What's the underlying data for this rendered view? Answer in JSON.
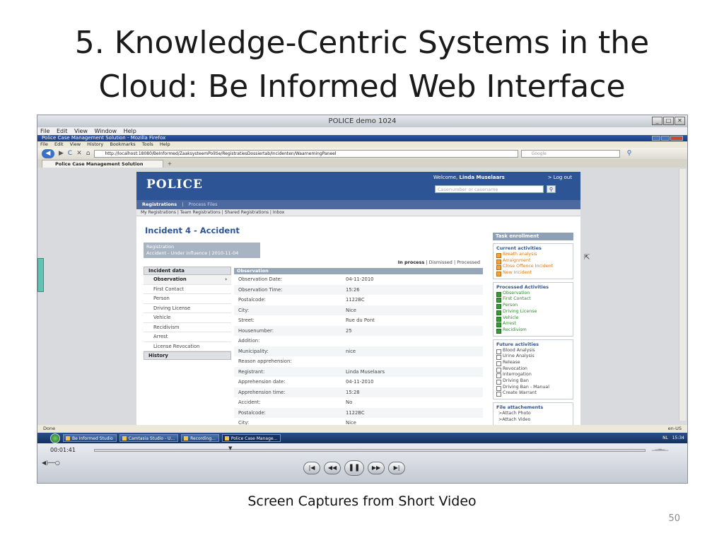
{
  "slide": {
    "title_line1": "5. Knowledge-Centric Systems in the",
    "title_line2": "Cloud: Be Informed Web Interface",
    "caption": "Screen Captures from Short Video",
    "page_number": "50"
  },
  "outer_window": {
    "title": "POLICE demo 1024",
    "menu": [
      "File",
      "Edit",
      "View",
      "Window",
      "Help"
    ]
  },
  "firefox": {
    "title": "Police Case Management Solution - Mozilla Firefox",
    "menu": [
      "File",
      "Edit",
      "View",
      "History",
      "Bookmarks",
      "Tools",
      "Help"
    ],
    "url": "http://localhost:18080/BeInformed/ZaaksysteemPolitie/RegistratiesDossiertab/Incidenten/WaarnemingPaneel",
    "search_placeholder": "Google",
    "tab_label": "Police Case Management Solution",
    "new_tab": "+",
    "status": "Done",
    "language": "en-US"
  },
  "app": {
    "logo": "POLICE",
    "welcome_prefix": "Welcome,",
    "user_name": "Linda Muselaars",
    "logout": "> Log out",
    "search_placeholder": "Casenumber or casename",
    "tabs": {
      "active": "Registrations",
      "sep": "|",
      "other": "Process Files"
    },
    "subnav": "My Registrations | Team Registrations | Shared Registrations | Inbox",
    "incident_title": "Incident 4 - Accident",
    "registration_label": "Registration",
    "registration_detail": "Accident - Under influence | 2010-11-04",
    "status": {
      "current": "In process",
      "rest": " | Dismissed | Processed"
    },
    "side_nav": {
      "header": "Incident data",
      "items": [
        "Observation",
        "First Contact",
        "Person",
        "Driving License",
        "Vehicle",
        "Recidivism",
        "Arrest",
        "License Revocation"
      ],
      "footer": "History"
    },
    "observation": {
      "header": "Observation",
      "rows": [
        {
          "k": "Observation Date:",
          "v": "04-11-2010"
        },
        {
          "k": "Observation Time:",
          "v": "15:26"
        },
        {
          "k": "Postalcode:",
          "v": "1122BC"
        },
        {
          "k": "City:",
          "v": "Nice"
        },
        {
          "k": "Street:",
          "v": "Rue du Pont"
        },
        {
          "k": "Housenumber:",
          "v": "25"
        },
        {
          "k": "Addition:",
          "v": ""
        },
        {
          "k": "Municipality:",
          "v": "nice"
        },
        {
          "k": "Reason apprehension:",
          "v": ""
        },
        {
          "k": "Registrant:",
          "v": "Linda Muselaars"
        },
        {
          "k": "Apprehension date:",
          "v": "04-11-2010"
        },
        {
          "k": "Apprehension time:",
          "v": "15:28"
        },
        {
          "k": "Accident:",
          "v": "No"
        },
        {
          "k": "Postalcode:",
          "v": "1122BC"
        },
        {
          "k": "City:",
          "v": "Nice"
        }
      ]
    },
    "task_panel": {
      "header": "Task enrollment",
      "current_title": "Current activities",
      "current": [
        "Breath analysis",
        "Arraignment",
        "Close Offence Incident",
        "New Incident"
      ],
      "processed_title": "Processed Activities",
      "processed": [
        "Observation",
        "First Contact",
        "Person",
        "Driving License",
        "Vehicle",
        "Arrest",
        "Recidivism"
      ],
      "future_title": "Future activities",
      "future": [
        "Blood Analysis",
        "Urine Analysis",
        "Release",
        "Revocation",
        "Interrogation",
        "Driving Ban",
        "Driving Ban - Manual",
        "Create Warrant"
      ],
      "attachments_title": "File attachements",
      "attachments": [
        ">Attach Photo",
        ">Attach Video"
      ]
    }
  },
  "taskbar": {
    "items": [
      "Be Informed Studio",
      "Camtasia Studio - U...",
      "Recording...",
      "Police Case Manage..."
    ],
    "clock": "15:34",
    "lang": "NL"
  },
  "player": {
    "time": "00:01:41",
    "buttons": [
      "skip-back",
      "rewind",
      "pause",
      "fast-forward",
      "skip-forward"
    ]
  }
}
